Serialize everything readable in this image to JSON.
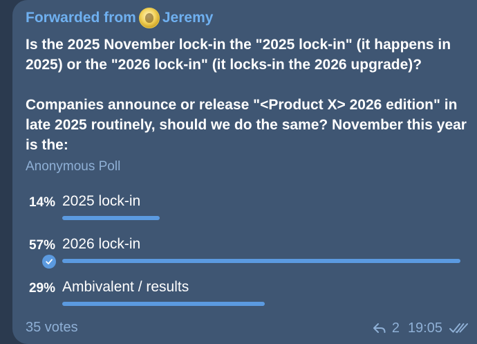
{
  "forward": {
    "prefix": "Forwarded from",
    "author": "Jeremy"
  },
  "question": {
    "paragraph1": "Is the 2025 November lock-in the \"2025 lock-in\" (it happens in 2025) or the \"2026 lock-in\" (it locks-in the 2026 upgrade)?",
    "paragraph2": "Companies announce or release \"<Product X> 2026 edition\" in late 2025 routinely, should we do the same?  November this year is the:"
  },
  "poll": {
    "type": "Anonymous Poll",
    "options": [
      {
        "percent_label": "14%",
        "label": "2025 lock-in",
        "fraction": 0.14,
        "selected": false
      },
      {
        "percent_label": "57%",
        "label": "2026 lock-in",
        "fraction": 0.57,
        "selected": true
      },
      {
        "percent_label": "29%",
        "label": "Ambivalent / results",
        "fraction": 0.29,
        "selected": false
      }
    ],
    "votes": "35 votes"
  },
  "footer": {
    "reply_count": "2",
    "time": "19:05"
  },
  "colors": {
    "background": "#2b3a4f",
    "bubble": "#3f5673",
    "accent": "#5b9ae0",
    "link": "#6fb0f0",
    "muted": "#8fb0d6",
    "text": "#ffffff"
  },
  "icons": {
    "avatar": "avatar-icon",
    "check": "check-circle-icon",
    "reply": "reply-icon",
    "read_receipt": "double-check-icon"
  }
}
